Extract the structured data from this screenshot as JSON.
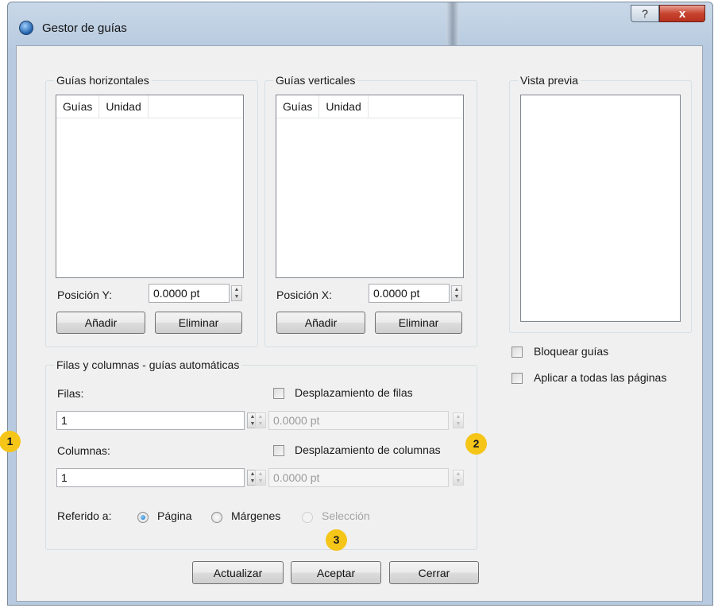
{
  "window": {
    "title": "Gestor de guías",
    "help_label": "?",
    "close_label": "x"
  },
  "horizontal": {
    "group_label": "Guías horizontales",
    "columns": [
      "Guías",
      "Unidad"
    ],
    "position_label": "Posición Y:",
    "position_value": "0.0000 pt",
    "add_label": "Añadir",
    "delete_label": "Eliminar"
  },
  "vertical": {
    "group_label": "Guías verticales",
    "columns": [
      "Guías",
      "Unidad"
    ],
    "position_label": "Posición X:",
    "position_value": "0.0000 pt",
    "add_label": "Añadir",
    "delete_label": "Eliminar"
  },
  "preview": {
    "group_label": "Vista previa"
  },
  "options": {
    "lock_label": "Bloquear guías",
    "apply_all_label": "Aplicar a todas las páginas"
  },
  "auto": {
    "group_label": "Filas y columnas - guías automáticas",
    "rows_label": "Filas:",
    "rows_value": "1",
    "row_offset_label": "Desplazamiento de filas",
    "row_offset_value": "0.0000 pt",
    "columns_label": "Columnas:",
    "columns_value": "1",
    "col_offset_label": "Desplazamiento de columnas",
    "col_offset_value": "0.0000 pt",
    "ref_label": "Referido a:",
    "ref_options": [
      "Página",
      "Márgenes",
      "Selección"
    ],
    "ref_selected": "Página"
  },
  "footer": {
    "update_label": "Actualizar",
    "accept_label": "Aceptar",
    "close_label": "Cerrar"
  },
  "callouts": [
    "1",
    "2",
    "3"
  ],
  "colors": {
    "callout": "#f5c518",
    "close_button": "#c8442f",
    "radio_selected": "#1a6fc2"
  }
}
